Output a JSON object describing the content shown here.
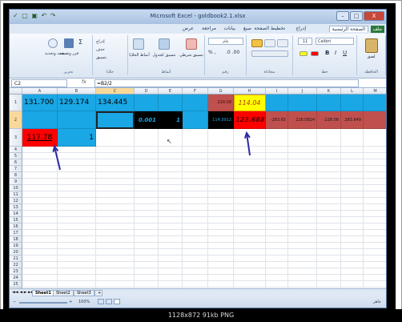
{
  "window": {
    "title": "Microsoft Excel - goldbook2.1.xlsx",
    "buttons": [
      "–",
      "□",
      "X"
    ]
  },
  "qat": "✓ ▢ ▣ ↶ ↷",
  "tabs": [
    {
      "label": "ملف",
      "active": false,
      "file": true
    },
    {
      "label": "الصفحة الرئيسية",
      "active": true
    },
    {
      "label": "إدراج",
      "active": false
    },
    {
      "label": "تخطيط الصفحة",
      "active": false
    },
    {
      "label": "صيغ",
      "active": false
    },
    {
      "label": "بيانات",
      "active": false
    },
    {
      "label": "مراجعة",
      "active": false
    },
    {
      "label": "عرض",
      "active": false
    }
  ],
  "ribbon": {
    "font_name": "Calibri",
    "font_size": "11",
    "groups": [
      "الحافظة",
      "خط",
      "محاذاة",
      "رقم",
      "أنماط",
      "خلايا",
      "تحرير"
    ],
    "buttons": {
      "paste": "لصق",
      "number_format": "عام",
      "conditional": "تنسيق شرطي",
      "format_table": "تنسيق كجدول",
      "cell_styles": "أنماط الخلايا",
      "insert": "إدراج",
      "delete": "حذف",
      "format": "تنسيق",
      "sort": "فرز وتصفية",
      "find": "بحث وتحديد"
    }
  },
  "formula_bar": {
    "name_box": "C2",
    "fx": "fx",
    "formula": "=B2/2"
  },
  "columns": [
    "A",
    "B",
    "C",
    "D",
    "E",
    "F",
    "G",
    "H",
    "I",
    "J",
    "K",
    "L",
    "M"
  ],
  "rows": [
    "1",
    "2",
    "3",
    "4",
    "5",
    "6",
    "7",
    "8",
    "9",
    "10",
    "11",
    "12",
    "13",
    "14",
    "15",
    "16",
    "17",
    "18",
    "19",
    "20",
    "21",
    "22",
    "23",
    "24",
    "25",
    "26",
    "27",
    "28",
    "29"
  ],
  "cells": {
    "A1": "131.700",
    "B1": "129.174",
    "C1": "134.445",
    "G1": "228.08",
    "H1": "114.04",
    "D2": "0.001",
    "E2": "1",
    "G2": "114.3912",
    "H2": "123.688",
    "I2": "-283.65",
    "J2": "228.0824",
    "K2": "-228.08",
    "L2": "283.649",
    "A3": "117.78",
    "B3": "1"
  },
  "sheets": [
    "Sheet1",
    "Sheet2",
    "Sheet3"
  ],
  "status": {
    "zoom": "100%",
    "ready": "جاهز"
  },
  "caption": "1128x872  91kb  PNG",
  "colors": {
    "blue_fill": "#19a7e6",
    "red_fill": "#ff0000",
    "dark_red": "#c0504d",
    "yellow": "#ffff00",
    "black": "#000000",
    "arrow": "#2a2aa8"
  }
}
